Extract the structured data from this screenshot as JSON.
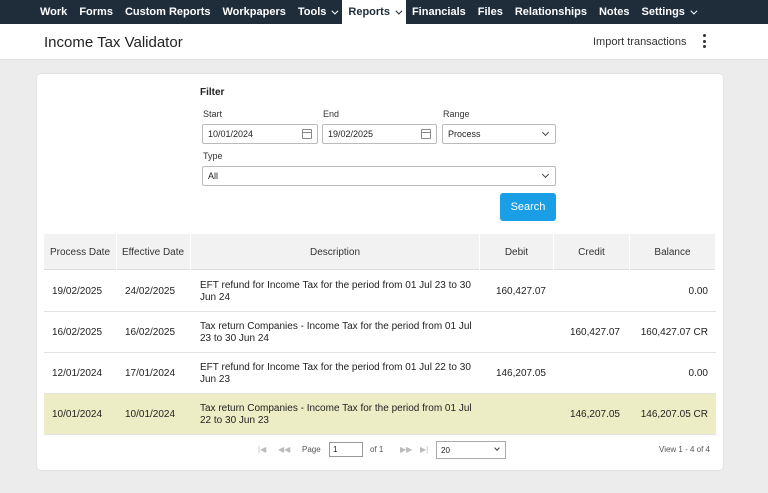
{
  "nav": [
    {
      "label": "Work",
      "dropdown": false,
      "active": false
    },
    {
      "label": "Forms",
      "dropdown": false,
      "active": false
    },
    {
      "label": "Custom Reports",
      "dropdown": false,
      "active": false
    },
    {
      "label": "Workpapers",
      "dropdown": false,
      "active": false
    },
    {
      "label": "Tools",
      "dropdown": true,
      "active": false
    },
    {
      "label": "Reports",
      "dropdown": true,
      "active": true
    },
    {
      "label": "Financials",
      "dropdown": false,
      "active": false
    },
    {
      "label": "Files",
      "dropdown": false,
      "active": false
    },
    {
      "label": "Relationships",
      "dropdown": false,
      "active": false
    },
    {
      "label": "Notes",
      "dropdown": false,
      "active": false
    },
    {
      "label": "Settings",
      "dropdown": true,
      "active": false
    }
  ],
  "header": {
    "title": "Income Tax Validator",
    "import_label": "Import transactions"
  },
  "filter": {
    "title": "Filter",
    "start_label": "Start",
    "start_value": "10/01/2024",
    "end_label": "End",
    "end_value": "19/02/2025",
    "range_label": "Range",
    "range_value": "Process",
    "type_label": "Type",
    "type_value": "All",
    "search_label": "Search"
  },
  "table": {
    "columns": [
      "Process Date",
      "Effective Date",
      "Description",
      "Debit",
      "Credit",
      "Balance"
    ],
    "rows": [
      {
        "process": "19/02/2025",
        "effective": "24/02/2025",
        "description": "EFT refund for Income Tax for the period from 01 Jul 23 to 30 Jun 24",
        "debit": "160,427.07",
        "credit": "",
        "balance": "0.00"
      },
      {
        "process": "16/02/2025",
        "effective": "16/02/2025",
        "description": "Tax return Companies - Income Tax for the period from 01 Jul 23 to 30 Jun 24",
        "debit": "",
        "credit": "160,427.07",
        "balance": "160,427.07 CR"
      },
      {
        "process": "12/01/2024",
        "effective": "17/01/2024",
        "description": "EFT refund for Income Tax for the period from 01 Jul 22 to 30 Jun 23",
        "debit": "146,207.05",
        "credit": "",
        "balance": "0.00"
      },
      {
        "process": "10/01/2024",
        "effective": "10/01/2024",
        "description": "Tax return Companies - Income Tax for the period from 01 Jul 22 to 30 Jun 23",
        "debit": "",
        "credit": "146,207.05",
        "balance": "146,207.05 CR",
        "selected": true
      }
    ]
  },
  "pager": {
    "page_label": "Page",
    "page_value": "1",
    "of_label": "of 1",
    "page_size": "20",
    "view_text": "View 1 - 4 of 4"
  },
  "colors": {
    "nav_bg": "#1f2d3b",
    "accent": "#1a9ee6",
    "selected_row": "#ececc5"
  }
}
